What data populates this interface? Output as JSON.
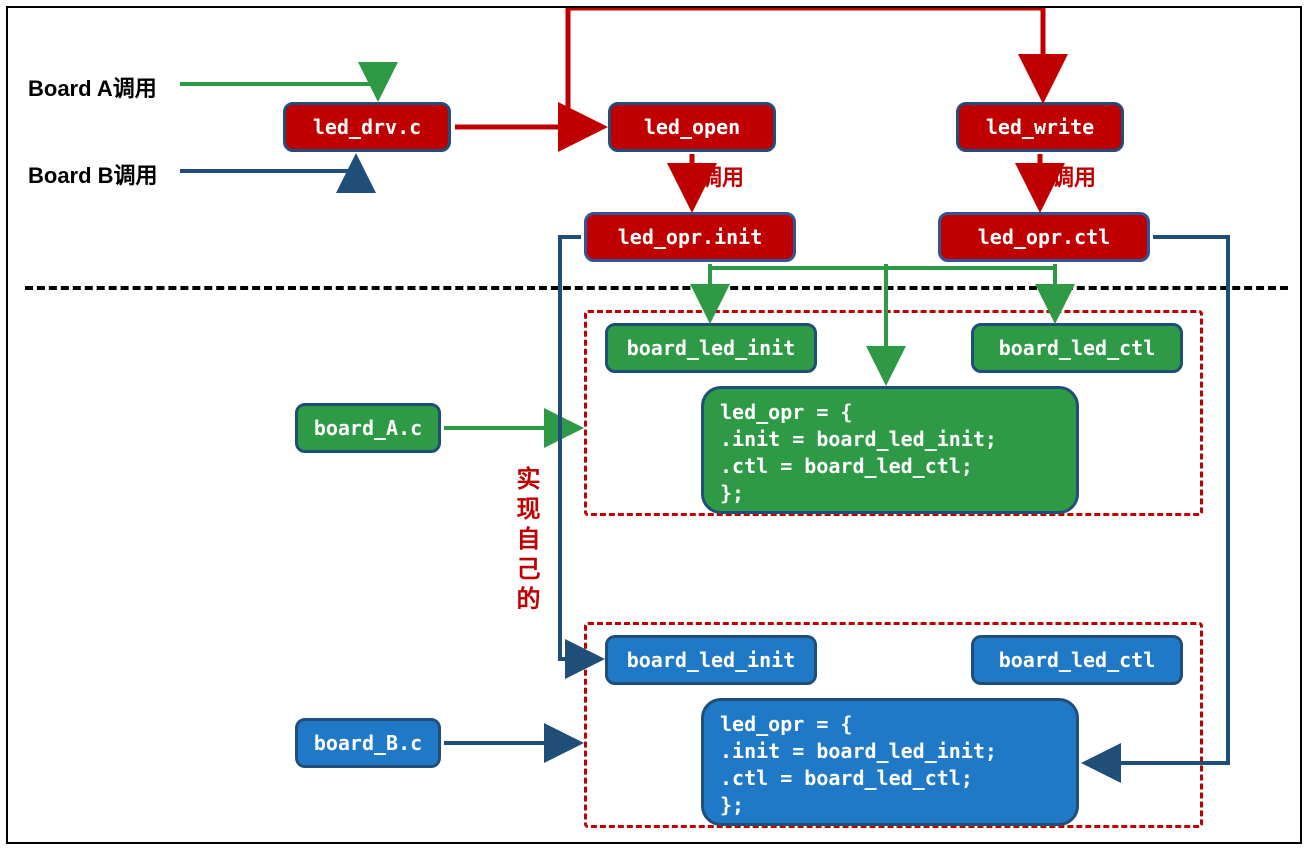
{
  "labels": {
    "board_a_call": "Board A调用",
    "board_b_call": "Board B调用"
  },
  "top_boxes": {
    "led_drv": "led_drv.c",
    "led_open": "led_open",
    "led_write": "led_write",
    "led_opr_init": "led_opr.init",
    "led_opr_ctl": "led_opr.ctl"
  },
  "call_labels": {
    "call1": "调用",
    "call2": "调用"
  },
  "side_boxes": {
    "board_a": "board_A.c",
    "board_b": "board_B.c"
  },
  "green_boxes": {
    "board_led_init": "board_led_init",
    "board_led_ctl": "board_led_ctl"
  },
  "blue_boxes": {
    "board_led_init": "board_led_init",
    "board_led_ctl": "board_led_ctl"
  },
  "code_green": {
    "l1": "led_opr = {",
    "l2": ".init = board_led_init;",
    "l3": ".ctl = board_led_ctl;",
    "l4": "};"
  },
  "code_blue": {
    "l1": "led_opr = {",
    "l2": ".init = board_led_init;",
    "l3": ".ctl = board_led_ctl;",
    "l4": "};"
  },
  "vertical_label": "实现自己的",
  "colors": {
    "red": "#c00000",
    "green": "#2e9a46",
    "blue": "#2079c7",
    "navy": "#1f4e79"
  }
}
